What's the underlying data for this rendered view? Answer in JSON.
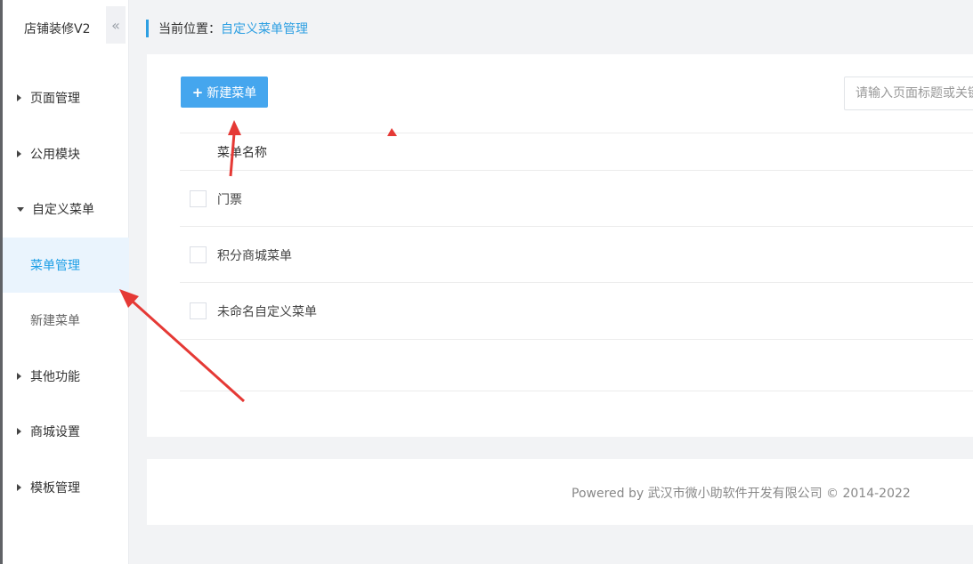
{
  "sidebar": {
    "store_title": "店铺装修V2",
    "collapse_icon": "«",
    "items": [
      {
        "label": "页面管理",
        "expanded": false
      },
      {
        "label": "公用模块",
        "expanded": false
      },
      {
        "label": "自定义菜单",
        "expanded": true
      },
      {
        "label": "其他功能",
        "expanded": false
      },
      {
        "label": "商城设置",
        "expanded": false
      },
      {
        "label": "模板管理",
        "expanded": false
      }
    ],
    "sub_items": [
      {
        "label": "菜单管理",
        "active": true
      },
      {
        "label": "新建菜单",
        "active": false
      }
    ]
  },
  "breadcrumb": {
    "label": "当前位置：",
    "current": "自定义菜单管理"
  },
  "toolbar": {
    "new_button_icon": "+",
    "new_button_label": "新建菜单",
    "search_placeholder": "请输入页面标题或关键字"
  },
  "table": {
    "header_name": "菜单名称",
    "rows": [
      {
        "name": "门票",
        "checked": false
      },
      {
        "name": "积分商城菜单",
        "checked": false
      },
      {
        "name": "未命名自定义菜单",
        "checked": false
      }
    ]
  },
  "footer": {
    "text": "Powered by 武汉市微小助软件开发有限公司 © 2014-2022"
  },
  "colors": {
    "accent": "#2d9fe2",
    "button": "#45a6ee",
    "annotation_arrow": "#e53935"
  }
}
